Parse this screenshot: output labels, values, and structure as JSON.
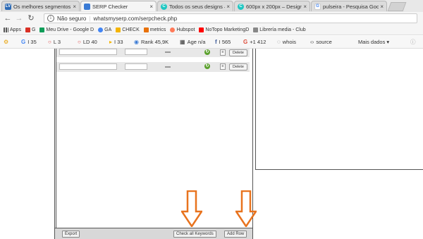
{
  "tabs": [
    {
      "title": "Os melhores segmentos",
      "favicon": "lv-logo",
      "color": "#2d6ab4",
      "active": false
    },
    {
      "title": "SERP Checker",
      "favicon": "serp-checker-icon",
      "color": "#3a7bd5",
      "active": true
    },
    {
      "title": "Todos os seus designs –",
      "favicon": "canva-icon",
      "color": "#1ec7c2",
      "active": false
    },
    {
      "title": "600px x 200px – Design",
      "favicon": "canva-icon",
      "color": "#1ec7c2",
      "active": false
    },
    {
      "title": "pulseira - Pesquisa Goog",
      "favicon": "google-icon",
      "color": "#4285f4",
      "active": false
    }
  ],
  "address": {
    "security": "Não seguro",
    "url": "whatsmyserp.com/serpcheck.php"
  },
  "bookmarks": [
    {
      "label": "Apps",
      "icon": "apps-grid-icon",
      "color": "#555"
    },
    {
      "label": "G",
      "icon": "gmail-icon",
      "color": "#d93025"
    },
    {
      "label": "Meu Drive - Google D",
      "icon": "drive-icon",
      "color": "#0f9d58"
    },
    {
      "label": "GA",
      "icon": "google-icon",
      "color": "#4285f4"
    },
    {
      "label": "CHECK",
      "icon": "drive-icon",
      "color": "#f4b400"
    },
    {
      "label": "metrics",
      "icon": "metrics-icon",
      "color": "#e8710a"
    },
    {
      "label": "Hubspot",
      "icon": "hubspot-icon",
      "color": "#ff7a59"
    },
    {
      "label": "NoTopo MarketingD",
      "icon": "youtube-icon",
      "color": "#ff0000"
    },
    {
      "label": "Librería media - Club",
      "icon": "page-icon",
      "color": "#888"
    }
  ],
  "seo_toolbar": [
    {
      "icon": "gear-icon",
      "symbol": "⚙",
      "label": "",
      "color": "#e8a000"
    },
    {
      "icon": "google-g-icon",
      "symbol": "G",
      "label": "I 35",
      "color": "#4285f4"
    },
    {
      "icon": "circle-icon",
      "symbol": "○",
      "label": "L 3",
      "color": "#d44"
    },
    {
      "icon": "circle-icon",
      "symbol": "○",
      "label": "LD 40",
      "color": "#d44"
    },
    {
      "icon": "play-icon",
      "symbol": "▸",
      "label": "I 33",
      "color": "#f4b400"
    },
    {
      "icon": "globe-icon",
      "symbol": "◉",
      "label": "Rank 45,9K",
      "color": "#3a7bd5"
    },
    {
      "icon": "calendar-icon",
      "symbol": "▦",
      "label": "Age n/a",
      "color": "#333"
    },
    {
      "icon": "facebook-icon",
      "symbol": "f",
      "label": "I 565",
      "color": "#3b5998"
    },
    {
      "icon": "googleplus-icon",
      "symbol": "G",
      "label": "+1 412",
      "color": "#dd4b39"
    },
    {
      "icon": "whois-icon",
      "symbol": "◌",
      "label": "whois",
      "color": "#555"
    },
    {
      "icon": "code-icon",
      "symbol": "‹›",
      "label": "source",
      "color": "#555"
    },
    {
      "icon": "",
      "symbol": "",
      "label": "Mais dados ▾",
      "color": "#333"
    }
  ],
  "rows": [
    {
      "delete_label": "Delete"
    },
    {
      "delete_label": "Delete"
    }
  ],
  "bottom": {
    "export_label": "Export",
    "check_all_label": "Check all Keywords",
    "add_row_label": "Add Row"
  },
  "accent_arrow_color": "#e8731e"
}
